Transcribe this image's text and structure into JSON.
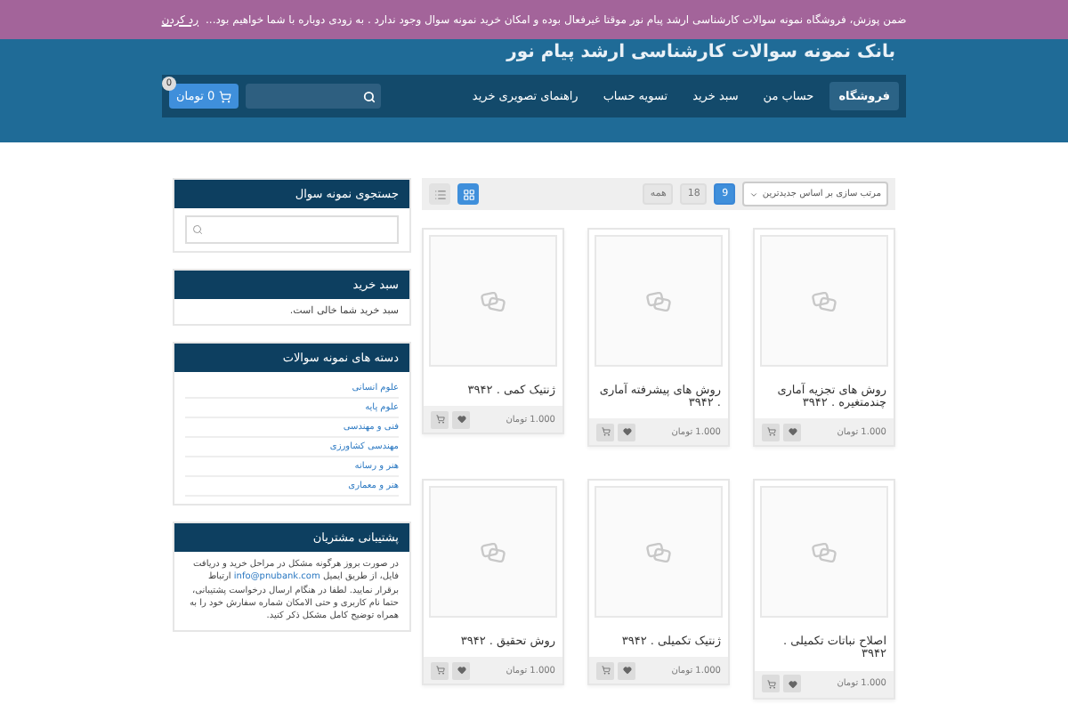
{
  "banner": {
    "text": "ضمن پوزش، فروشگاه نمونه سوالات کارشناسی ارشد پیام نور موقتا غیرفعال بوده و امکان خرید نمونه سوال وجود ندارد . به زودی دوباره با شما خواهیم بود...",
    "dismiss": "رد کردن"
  },
  "site_title": "بانک نمونه سوالات کارشناسی ارشد پیام نور",
  "nav": {
    "items": [
      {
        "label": "فروشگاه",
        "selected": true
      },
      {
        "label": "حساب من",
        "selected": false
      },
      {
        "label": "سبد خرید",
        "selected": false
      },
      {
        "label": "تسویه حساب",
        "selected": false
      },
      {
        "label": "راهنمای تصویری خرید",
        "selected": false
      }
    ],
    "cart": {
      "label": "0 تومان",
      "badge": "0"
    }
  },
  "toolbar": {
    "sort": "مرتب سازی بر اساس جدیدترین",
    "per_page": [
      {
        "label": "9",
        "selected": true
      },
      {
        "label": "18",
        "selected": false
      },
      {
        "label": "همه",
        "selected": false
      }
    ],
    "views": [
      {
        "kind": "grid",
        "selected": true
      },
      {
        "kind": "list",
        "selected": false
      }
    ]
  },
  "products": [
    {
      "title": "روش های تجزیه آماری چندمتغیره . ۳۹۴۲",
      "price": "1.000 تومان"
    },
    {
      "title": "روش های پیشرفته آماری . ۳۹۴۲",
      "price": "1.000 تومان"
    },
    {
      "title": "ژنتیک کمی . ۳۹۴۲",
      "price": "1.000 تومان"
    },
    {
      "title": "اصلاح نباتات تکمیلی . ۳۹۴۲",
      "price": "1.000 تومان"
    },
    {
      "title": "ژنتیک تکمیلی . ۳۹۴۲",
      "price": "1.000 تومان"
    },
    {
      "title": "روش تحقیق . ۳۹۴۲",
      "price": "1.000 تومان"
    }
  ],
  "sidebar": [
    {
      "kind": "search",
      "title": "جستجوی نمونه سوال"
    },
    {
      "kind": "text",
      "title": "سبد خرید",
      "text": "سبد خرید شما خالی است."
    },
    {
      "kind": "links",
      "title": "دسته های نمونه سوالات",
      "items": [
        "علوم انسانی",
        "علوم پایه",
        "فنی و مهندسی",
        "مهندسی کشاورزی",
        "هنر و رسانه",
        "هنر و معماری"
      ]
    },
    {
      "kind": "support",
      "title": "پشتیبانی مشتریان",
      "before": "در صورت بروز هرگونه مشکل در مراحل خرید و دریافت فایل، از طریق ایمیل",
      "link": "info@pnubank.com",
      "after": "ارتباط برقرار نمایید. لطفا در هنگام ارسال درخواست پشتیبانی، حتما نام کاربری و حتی الامکان شماره سفارش خود را به همراه توضیح کامل مشکل ذکر کنید."
    }
  ]
}
